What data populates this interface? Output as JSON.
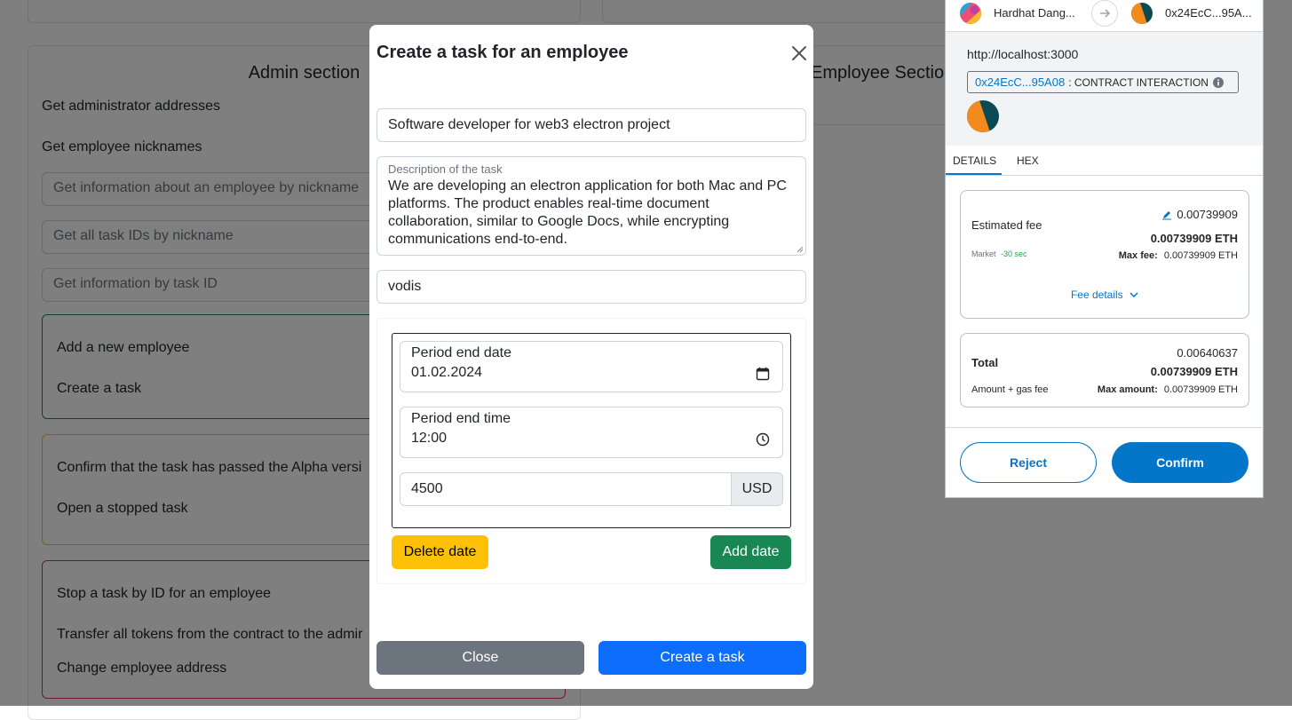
{
  "admin_section": {
    "title": "Admin section",
    "items": {
      "get_admin_addresses": "Get administrator addresses",
      "get_employee_nicknames": "Get employee nicknames"
    },
    "inputs": {
      "info_by_nickname_placeholder": "Get information about an employee by nickname",
      "task_ids_placeholder": "Get all task IDs by nickname",
      "info_by_task_id_placeholder": "Get information by task ID"
    },
    "green_group": {
      "add_employee": "Add a new employee",
      "create_task": "Create a task"
    },
    "orange_group": {
      "confirm_alpha": "Confirm that the task has passed the Alpha versi",
      "open_stopped": "Open a stopped task"
    },
    "red_group": {
      "stop_task": "Stop a task by ID for an employee",
      "transfer_tokens": "Transfer all tokens from the contract to the admir",
      "change_address": "Change employee address"
    }
  },
  "employee_section": {
    "title": "Employee Section"
  },
  "modal": {
    "title": "Create a task for an employee",
    "task_title_value": "Software developer for web3 electron project",
    "description_label": "Description of the task",
    "description_value": "We are developing an electron application for both Mac and PC platforms. The product enables real-time document collaboration, similar to Google Docs, while encrypting communications end-to-end.",
    "nickname_value": "vodis",
    "period_end_date_label": "Period end date",
    "period_end_date_value": "01.02.2024",
    "period_end_time_label": "Period end time",
    "period_end_time_value": "12:00",
    "amount_value": "4500",
    "currency": "USD",
    "delete_date_button": "Delete date",
    "add_date_button": "Add date",
    "close_button": "Close",
    "create_button": "Create a task"
  },
  "metamask": {
    "from_account": "Hardhat Dang...",
    "to_account": "0x24EcC...95A...",
    "origin": "http://localhost:3000",
    "contract_address": "0x24EcC...95A08",
    "contract_label": ": CONTRACT INTERACTION",
    "tabs": [
      "DETAILS",
      "HEX"
    ],
    "estimated_fee_label": "Estimated fee",
    "estimated_fee_value": "0.00739909",
    "estimated_fee_eth": "0.00739909 ETH",
    "market_label": "Market",
    "market_time": "-30 sec",
    "max_fee_label": "Max fee:",
    "max_fee_value": "0.00739909 ETH",
    "fee_details_link": "Fee details",
    "total_label": "Total",
    "total_value": "0.00640637",
    "total_eth": "0.00739909 ETH",
    "amount_gas_label": "Amount + gas fee",
    "max_amount_label": "Max amount:",
    "max_amount_value": "0.00739909 ETH",
    "reject_button": "Reject",
    "confirm_button": "Confirm"
  },
  "colors": {
    "primary": "#0d6efd",
    "success": "#198754",
    "warning": "#ffc107",
    "secondary": "#6c757d",
    "metamask_blue": "#0376c9",
    "metamask_green": "#28a745"
  }
}
